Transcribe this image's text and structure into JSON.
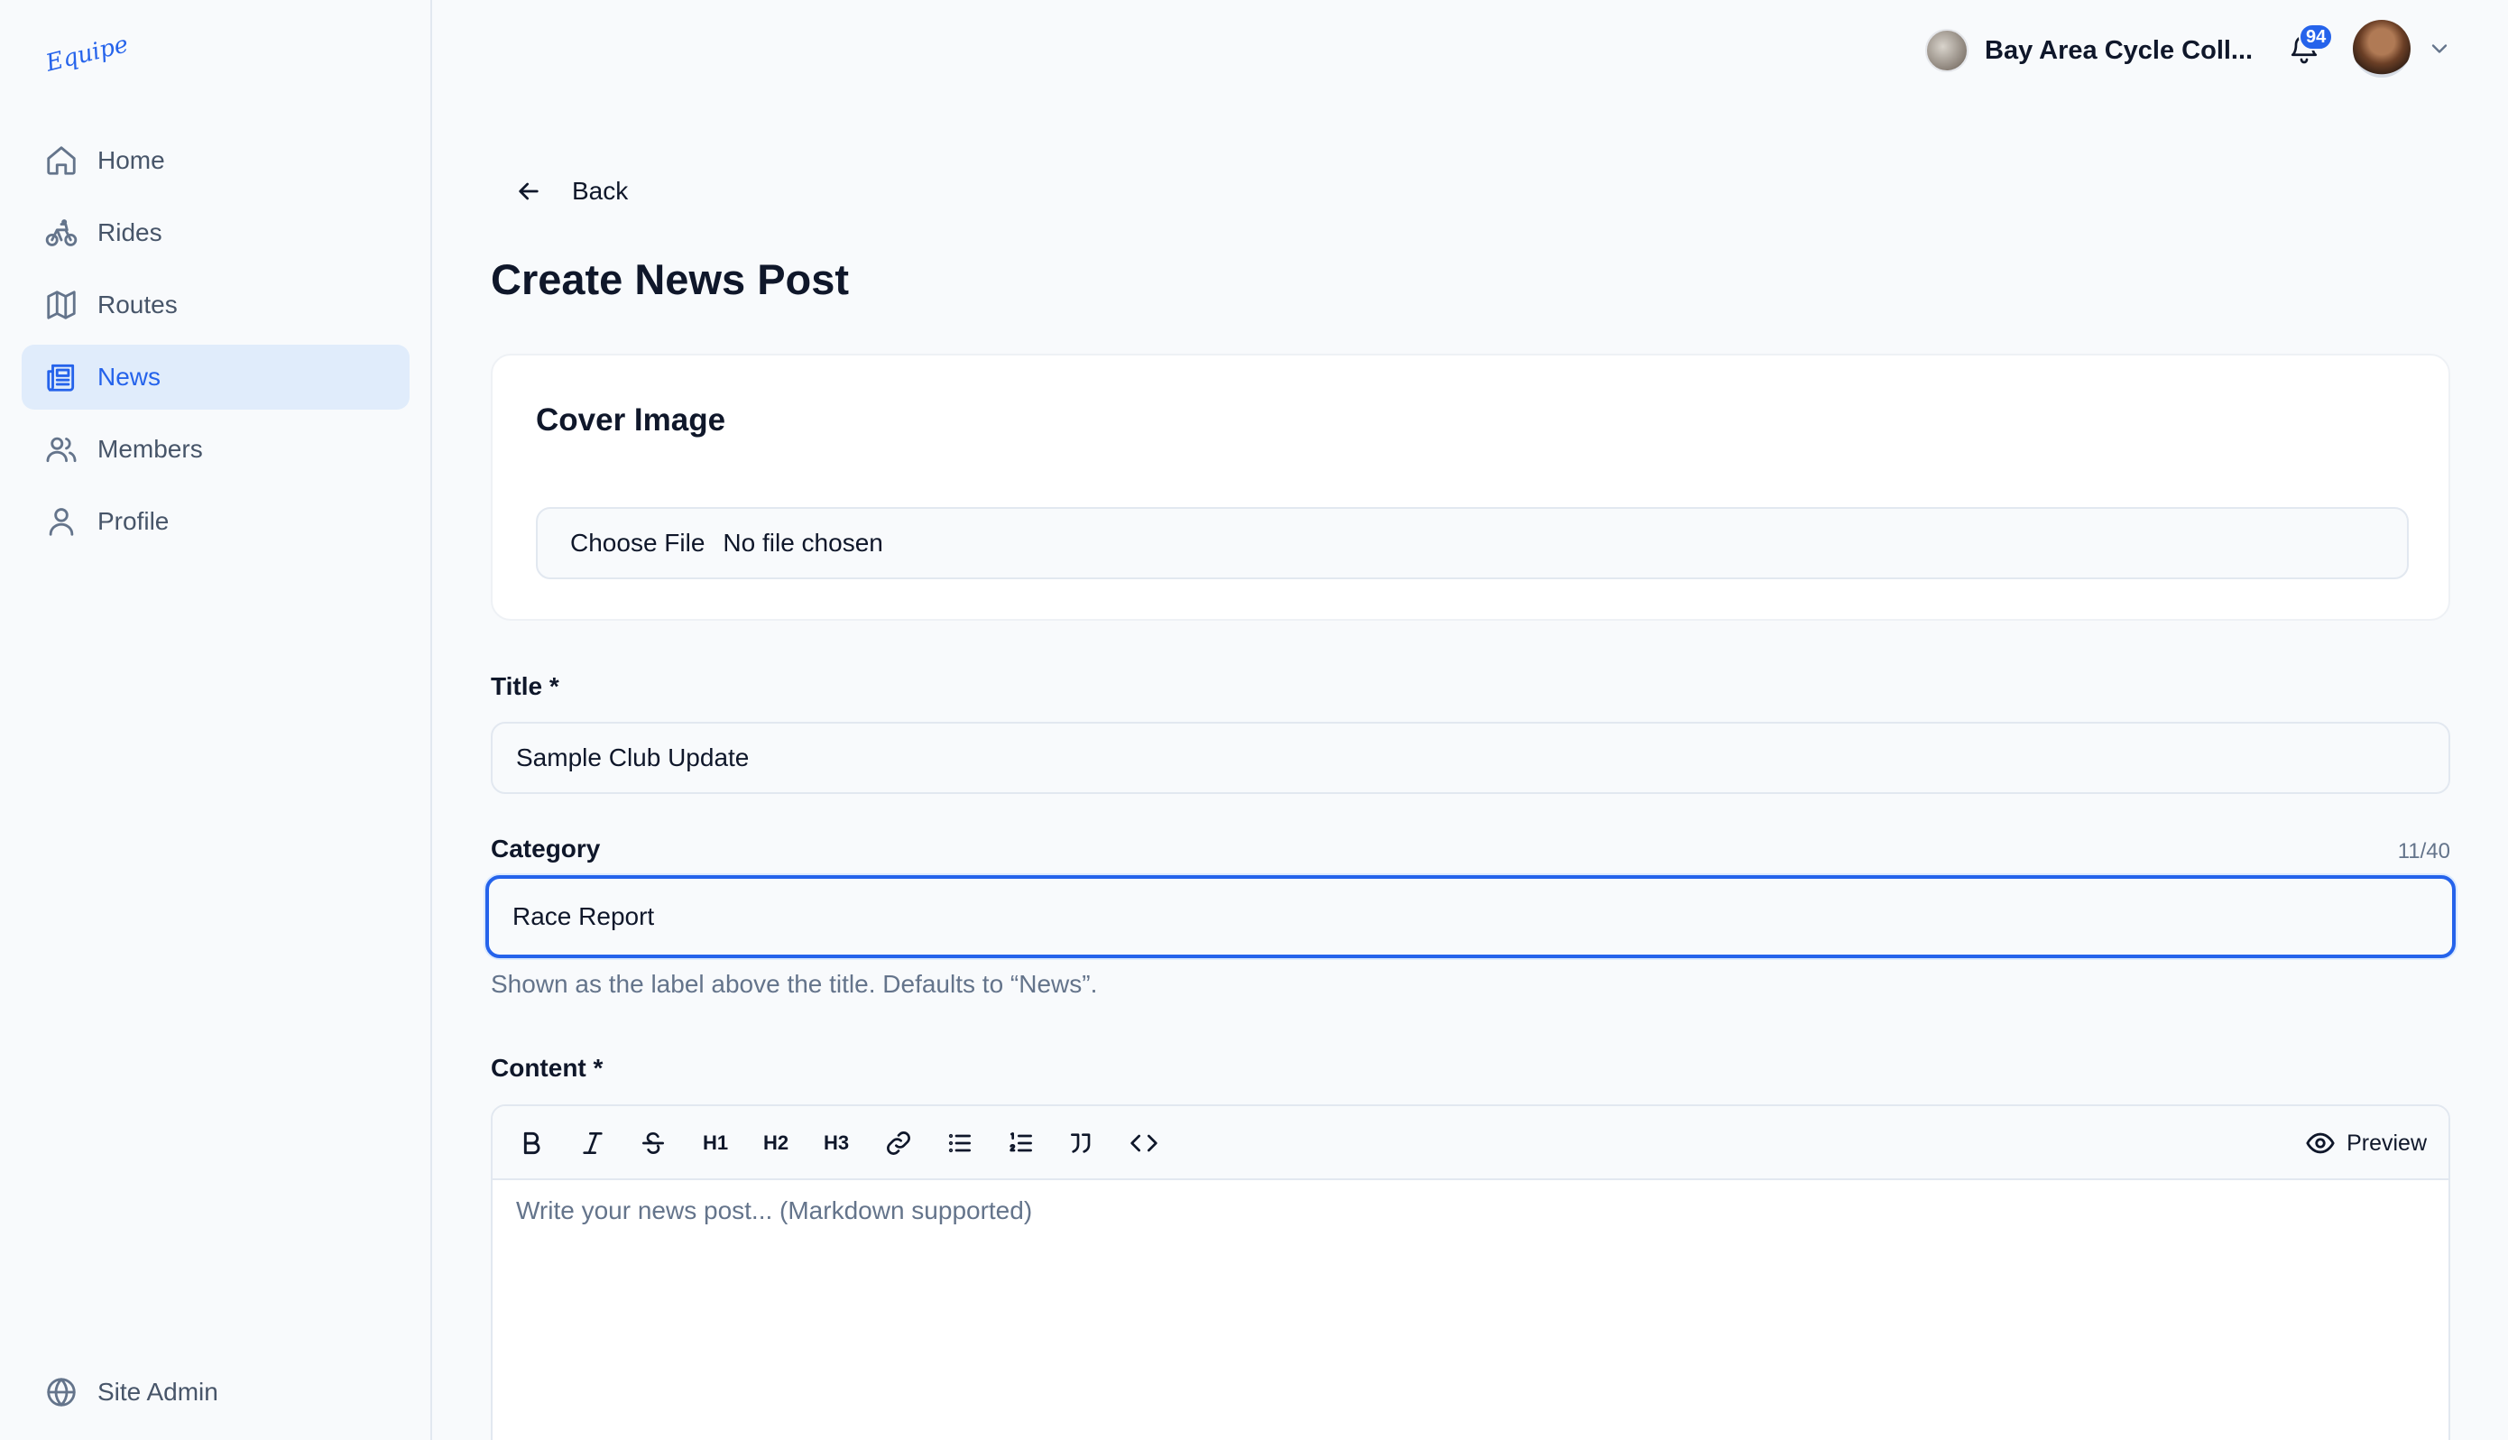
{
  "brand": {
    "logo_text": "Equipe"
  },
  "sidebar": {
    "items": [
      {
        "label": "Home",
        "icon": "home-icon",
        "active": false
      },
      {
        "label": "Rides",
        "icon": "bicycle-icon",
        "active": false
      },
      {
        "label": "Routes",
        "icon": "map-icon",
        "active": false
      },
      {
        "label": "News",
        "icon": "newspaper-icon",
        "active": true
      },
      {
        "label": "Members",
        "icon": "users-icon",
        "active": false
      },
      {
        "label": "Profile",
        "icon": "user-icon",
        "active": false
      }
    ],
    "footer": {
      "label": "Site Admin",
      "icon": "globe-icon"
    }
  },
  "topbar": {
    "club_name": "Bay Area Cycle Coll...",
    "notification_count": "94"
  },
  "page": {
    "back_label": "Back",
    "title": "Create News Post"
  },
  "cover": {
    "title": "Cover Image",
    "button_label": "Choose File",
    "status": "No file chosen"
  },
  "fields": {
    "title_label": "Title *",
    "title_value": "Sample Club Update",
    "category_label": "Category",
    "category_value": "Race Report",
    "category_counter": "11/40",
    "category_helper": "Shown as the label above the title. Defaults to “News”.",
    "content_label": "Content *",
    "content_placeholder": "Write your news post... (Markdown supported)"
  },
  "editor": {
    "toolbar": [
      "bold",
      "italic",
      "strikethrough",
      "heading-1",
      "heading-2",
      "heading-3",
      "link",
      "bullet-list",
      "numbered-list",
      "quote",
      "code"
    ],
    "h1": "H1",
    "h2": "H2",
    "h3": "H3",
    "preview_label": "Preview"
  },
  "colors": {
    "accent": "#2563eb",
    "active_bg": "#e0ecfb",
    "muted": "#64748b"
  }
}
